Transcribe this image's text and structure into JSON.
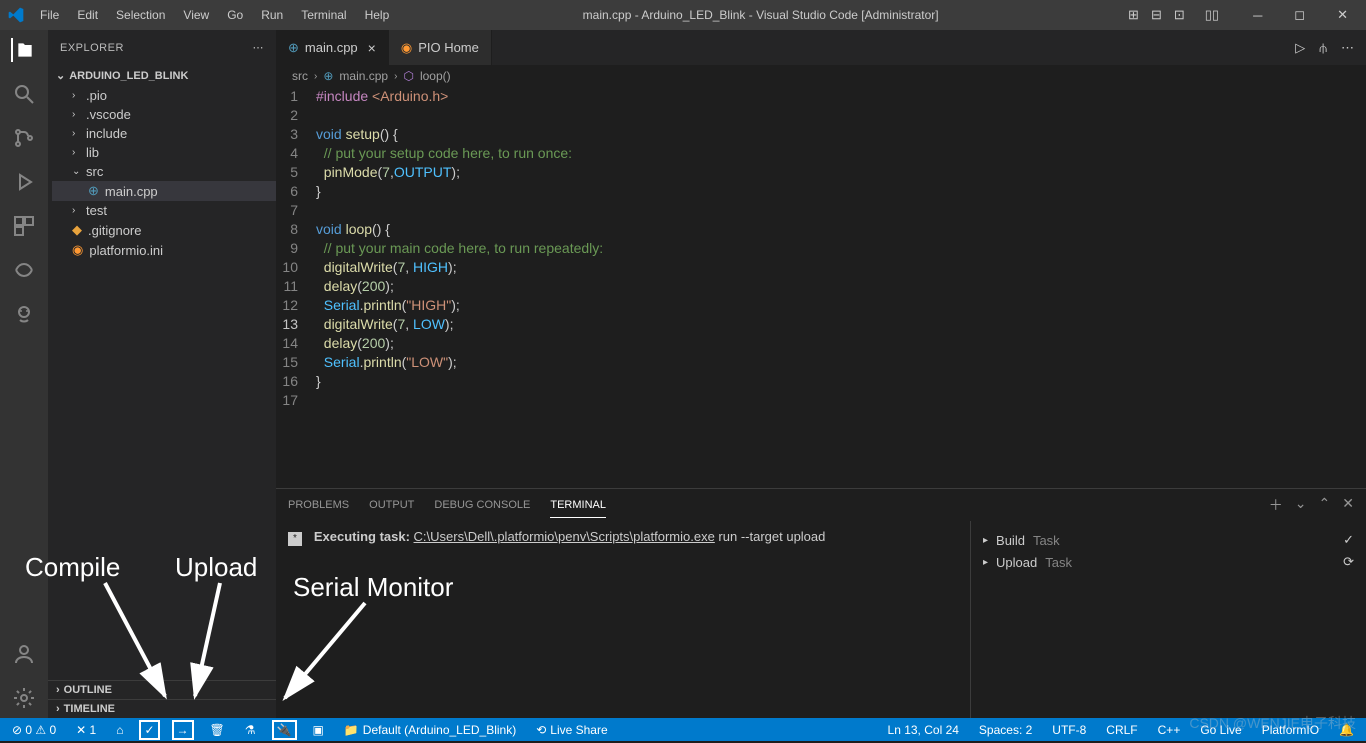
{
  "titlebar": {
    "menus": [
      "File",
      "Edit",
      "Selection",
      "View",
      "Go",
      "Run",
      "Terminal",
      "Help"
    ],
    "title": "main.cpp - Arduino_LED_Blink - Visual Studio Code [Administrator]"
  },
  "sidebar": {
    "header": "EXPLORER",
    "folder": "ARDUINO_LED_BLINK",
    "items": [
      {
        "label": ".pio",
        "type": "folder"
      },
      {
        "label": ".vscode",
        "type": "folder"
      },
      {
        "label": "include",
        "type": "folder"
      },
      {
        "label": "lib",
        "type": "folder"
      },
      {
        "label": "src",
        "type": "folder",
        "open": true
      },
      {
        "label": "main.cpp",
        "type": "file-cpp",
        "nested": true,
        "selected": true
      },
      {
        "label": "test",
        "type": "folder"
      },
      {
        "label": ".gitignore",
        "type": "file-git"
      },
      {
        "label": "platformio.ini",
        "type": "file-pio"
      }
    ],
    "sections": [
      "OUTLINE",
      "TIMELINE"
    ]
  },
  "tabs": [
    {
      "label": "main.cpp",
      "icon": "cpp",
      "active": true,
      "close": true
    },
    {
      "label": "PIO Home",
      "icon": "pio",
      "active": false
    }
  ],
  "breadcrumb": [
    "src",
    "main.cpp",
    "loop()"
  ],
  "code": [
    {
      "n": 1,
      "html": "<span class='pre'>#include</span> <span class='str'>&lt;Arduino.h&gt;</span>"
    },
    {
      "n": 2,
      "html": ""
    },
    {
      "n": 3,
      "html": "<span class='kw'>void</span> <span class='fn'>setup</span>() {"
    },
    {
      "n": 4,
      "html": "  <span class='comment'>// put your setup code here, to run once:</span>"
    },
    {
      "n": 5,
      "html": "  <span class='fn'>pinMode</span>(<span class='num'>7</span>,<span class='const'>OUTPUT</span>);"
    },
    {
      "n": 6,
      "html": "}"
    },
    {
      "n": 7,
      "html": ""
    },
    {
      "n": 8,
      "html": "<span class='kw'>void</span> <span class='fn'>loop</span>() {"
    },
    {
      "n": 9,
      "html": "  <span class='comment'>// put your main code here, to run repeatedly:</span>"
    },
    {
      "n": 10,
      "html": "  <span class='fn'>digitalWrite</span>(<span class='num'>7</span>, <span class='const'>HIGH</span>);"
    },
    {
      "n": 11,
      "html": "  <span class='fn'>delay</span>(<span class='num'>200</span>);"
    },
    {
      "n": 12,
      "html": "  <span class='const'>Serial</span>.<span class='fn'>println</span>(<span class='str'>\"HIGH\"</span>);"
    },
    {
      "n": 13,
      "html": "  <span class='fn'>digitalWrite</span>(<span class='num'>7</span>, <span class='const'>LOW</span>);",
      "active": true
    },
    {
      "n": 14,
      "html": "  <span class='fn'>delay</span>(<span class='num'>200</span>);"
    },
    {
      "n": 15,
      "html": "  <span class='const'>Serial</span>.<span class='fn'>println</span>(<span class='str'>\"LOW\"</span>);"
    },
    {
      "n": 16,
      "html": "}"
    },
    {
      "n": 17,
      "html": ""
    }
  ],
  "panel": {
    "tabs": [
      "PROBLEMS",
      "OUTPUT",
      "DEBUG CONSOLE",
      "TERMINAL"
    ],
    "active": "TERMINAL",
    "terminal_prefix": "Executing task: ",
    "terminal_path": "C:\\Users\\Dell\\.platformio\\penv\\Scripts\\platformio.exe",
    "terminal_suffix": " run --target upload",
    "tasks": [
      {
        "label": "Build",
        "sub": "Task",
        "status": "✓"
      },
      {
        "label": "Upload",
        "sub": "Task",
        "status": "⟳"
      }
    ]
  },
  "statusbar": {
    "remote": "⊘ 0 ⚠ 0",
    "tools": "✕ 1",
    "project": "Default (Arduino_LED_Blink)",
    "liveshare": "Live Share",
    "position": "Ln 13, Col 24",
    "spaces": "Spaces: 2",
    "encoding": "UTF-8",
    "eol": "CRLF",
    "lang": "C++",
    "golive": "Go Live",
    "pio": "PlatformIO",
    "bell": "🔔"
  },
  "annotations": {
    "compile": "Compile",
    "upload": "Upload",
    "serial": "Serial Monitor"
  },
  "watermark": "CSDN @WENJIE电子科技"
}
